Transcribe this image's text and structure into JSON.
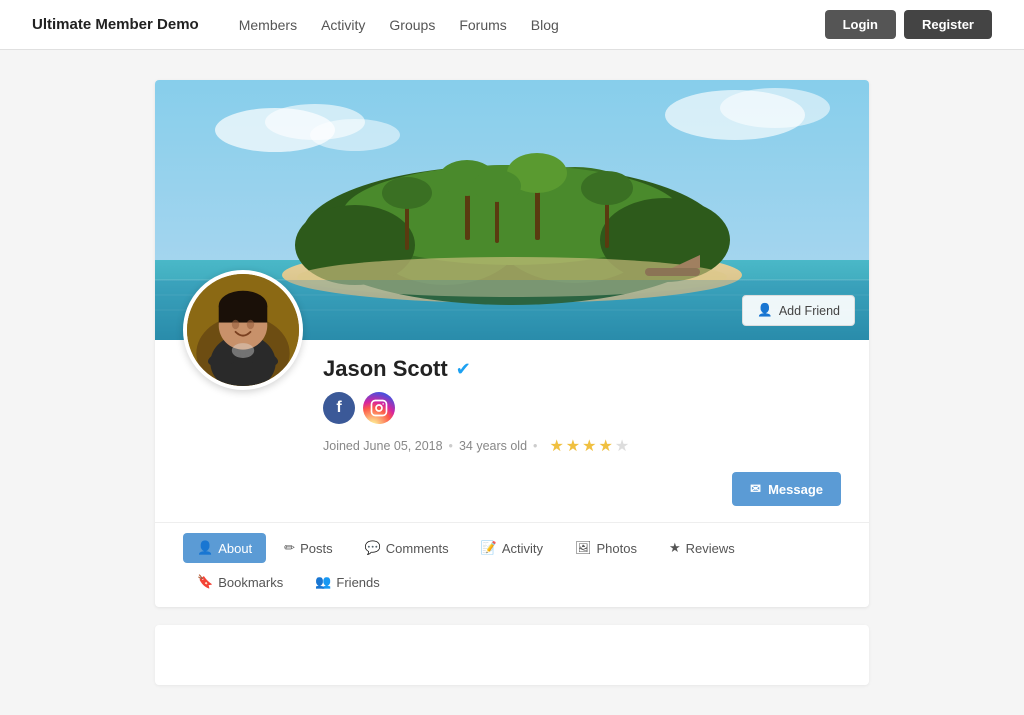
{
  "site": {
    "logo": "Ultimate Member Demo"
  },
  "nav": {
    "items": [
      {
        "label": "Members",
        "href": "#"
      },
      {
        "label": "Activity",
        "href": "#"
      },
      {
        "label": "Groups",
        "href": "#"
      },
      {
        "label": "Forums",
        "href": "#"
      },
      {
        "label": "Blog",
        "href": "#"
      }
    ]
  },
  "header_actions": {
    "login": "Login",
    "register": "Register"
  },
  "profile": {
    "name": "Jason Scott",
    "joined": "Joined June 05, 2018",
    "age": "34 years old",
    "dot": "•",
    "stars": [
      true,
      true,
      true,
      true,
      false
    ],
    "add_friend": "Add Friend",
    "message": "Message"
  },
  "tabs": [
    {
      "label": "About",
      "active": true,
      "icon": "person"
    },
    {
      "label": "Posts",
      "active": false,
      "icon": "pencil"
    },
    {
      "label": "Comments",
      "active": false,
      "icon": "chat"
    },
    {
      "label": "Activity",
      "active": false,
      "icon": "edit"
    },
    {
      "label": "Photos",
      "active": false,
      "icon": "photo"
    },
    {
      "label": "Reviews",
      "active": false,
      "icon": "star"
    },
    {
      "label": "Bookmarks",
      "active": false,
      "icon": "bookmark"
    },
    {
      "label": "Friends",
      "active": false,
      "icon": "friends"
    }
  ]
}
